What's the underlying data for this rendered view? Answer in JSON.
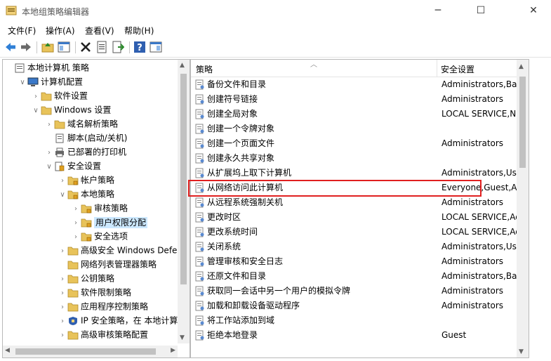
{
  "window": {
    "title": "本地组策略编辑器"
  },
  "menu": [
    "文件(F)",
    "操作(A)",
    "查看(V)",
    "帮助(H)"
  ],
  "toolbar": {
    "icons": [
      "back-arrow-icon",
      "forward-arrow-icon",
      "up-folder-icon",
      "show-hide-tree-icon",
      "delete-icon",
      "properties-icon",
      "export-list-icon",
      "help-icon",
      "console-icon"
    ]
  },
  "tree": [
    {
      "label": "本地计算机 策略",
      "indent": 0,
      "exp": "",
      "icon": "computer-policy-icon"
    },
    {
      "label": "计算机配置",
      "indent": 1,
      "exp": "∨",
      "icon": "computer-config-icon"
    },
    {
      "label": "软件设置",
      "indent": 2,
      "exp": "›",
      "icon": "folder-icon"
    },
    {
      "label": "Windows 设置",
      "indent": 2,
      "exp": "∨",
      "icon": "folder-icon"
    },
    {
      "label": "域名解析策略",
      "indent": 3,
      "exp": "›",
      "icon": "folder-icon"
    },
    {
      "label": "脚本(启动/关机)",
      "indent": 3,
      "exp": "",
      "icon": "script-icon"
    },
    {
      "label": "已部署的打印机",
      "indent": 3,
      "exp": "›",
      "icon": "printer-icon"
    },
    {
      "label": "安全设置",
      "indent": 3,
      "exp": "∨",
      "icon": "security-icon"
    },
    {
      "label": "帐户策略",
      "indent": 4,
      "exp": "›",
      "icon": "folder-lock-icon"
    },
    {
      "label": "本地策略",
      "indent": 4,
      "exp": "∨",
      "icon": "folder-lock-icon"
    },
    {
      "label": "审核策略",
      "indent": 5,
      "exp": "›",
      "icon": "folder-lock-icon"
    },
    {
      "label": "用户权限分配",
      "indent": 5,
      "exp": "›",
      "icon": "folder-lock-icon",
      "selected": true
    },
    {
      "label": "安全选项",
      "indent": 5,
      "exp": "›",
      "icon": "folder-lock-icon"
    },
    {
      "label": "高级安全 Windows Defende",
      "indent": 4,
      "exp": "›",
      "icon": "folder-icon"
    },
    {
      "label": "网络列表管理器策略",
      "indent": 4,
      "exp": "",
      "icon": "folder-icon"
    },
    {
      "label": "公钥策略",
      "indent": 4,
      "exp": "›",
      "icon": "folder-icon"
    },
    {
      "label": "软件限制策略",
      "indent": 4,
      "exp": "›",
      "icon": "folder-icon"
    },
    {
      "label": "应用程序控制策略",
      "indent": 4,
      "exp": "›",
      "icon": "folder-icon"
    },
    {
      "label": "IP 安全策略，在 本地计算机",
      "indent": 4,
      "exp": "›",
      "icon": "ip-security-icon"
    },
    {
      "label": "高级审核策略配置",
      "indent": 4,
      "exp": "›",
      "icon": "folder-icon"
    }
  ],
  "list": {
    "headers": {
      "policy": "策略",
      "setting": "安全设置"
    },
    "rows": [
      {
        "policy": "备份文件和目录",
        "setting": "Administrators,Backup"
      },
      {
        "policy": "创建符号链接",
        "setting": "Administrators"
      },
      {
        "policy": "创建全局对象",
        "setting": "LOCAL SERVICE,NETWORK"
      },
      {
        "policy": "创建一个令牌对象",
        "setting": ""
      },
      {
        "policy": "创建一个页面文件",
        "setting": "Administrators"
      },
      {
        "policy": "创建永久共享对象",
        "setting": ""
      },
      {
        "policy": "从扩展坞上取下计算机",
        "setting": "Administrators,Users"
      },
      {
        "policy": "从网络访问此计算机",
        "setting": "Everyone,Guest,Administrators"
      },
      {
        "policy": "从远程系统强制关机",
        "setting": "Administrators"
      },
      {
        "policy": "更改时区",
        "setting": "LOCAL SERVICE,Administrators"
      },
      {
        "policy": "更改系统时间",
        "setting": "LOCAL SERVICE,Administrators"
      },
      {
        "policy": "关闭系统",
        "setting": "Administrators,Users"
      },
      {
        "policy": "管理审核和安全日志",
        "setting": "Administrators"
      },
      {
        "policy": "还原文件和目录",
        "setting": "Administrators,Backup"
      },
      {
        "policy": "获取同一会话中另一个用户的模拟令牌",
        "setting": "Administrators"
      },
      {
        "policy": "加载和卸载设备驱动程序",
        "setting": "Administrators"
      },
      {
        "policy": "将工作站添加到域",
        "setting": ""
      },
      {
        "policy": "拒绝本地登录",
        "setting": "Guest"
      }
    ]
  },
  "colors": {
    "highlight_border": "#e02020",
    "selected_bg": "#cce8ff",
    "folder": "#e8c35a"
  }
}
